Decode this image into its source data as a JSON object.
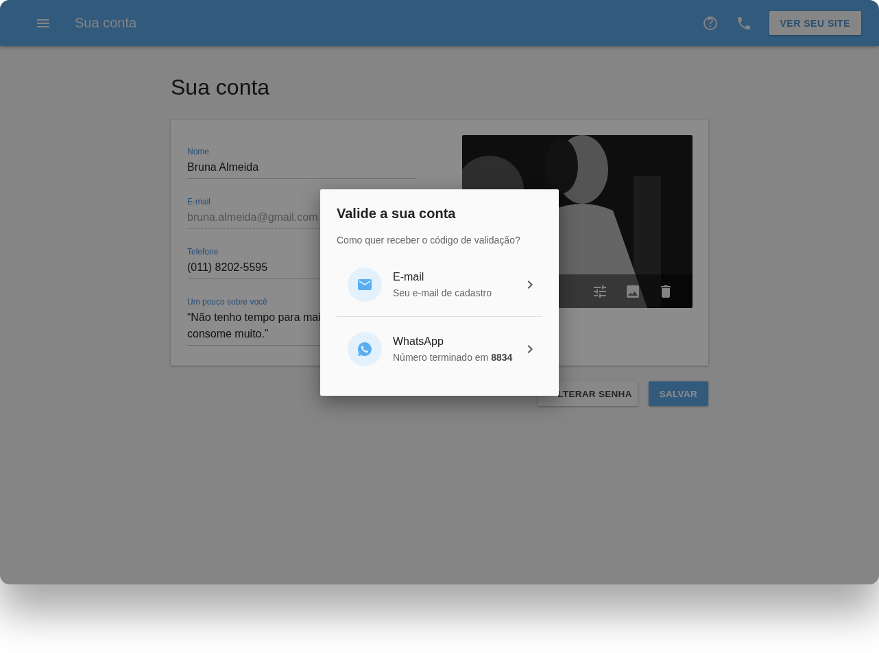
{
  "app_bar": {
    "title": "Sua conta",
    "button": "VER SEU SITE"
  },
  "page": {
    "title": "Sua conta"
  },
  "fields": [
    {
      "label": "Nome",
      "value": "Bruna Almeida",
      "disabled": false
    },
    {
      "label": "E-mail",
      "value": "bruna.almeida@gmail.com",
      "disabled": true
    },
    {
      "label": "Telefone",
      "value": "(011) 8202-5595",
      "disabled": false
    },
    {
      "label": "Um pouco sobre você",
      "value": "“Não tenho tempo para mai\nconsome muito.”",
      "disabled": false
    }
  ],
  "buttons": [
    {
      "label": "LTERAR SENHA",
      "kind": "outlined"
    },
    {
      "label": "SALVAR",
      "kind": "primary"
    }
  ],
  "dialog": {
    "title": "Valide a sua conta",
    "prompt": "Como quer receber o código de validação?",
    "options": [
      {
        "kind": "email",
        "title": "E-mail",
        "subtitle": "Seu e-mail de cadastro"
      },
      {
        "kind": "whatsapp",
        "title": "WhatsApp",
        "subtitle": "Número terminado em **8834**"
      }
    ]
  }
}
